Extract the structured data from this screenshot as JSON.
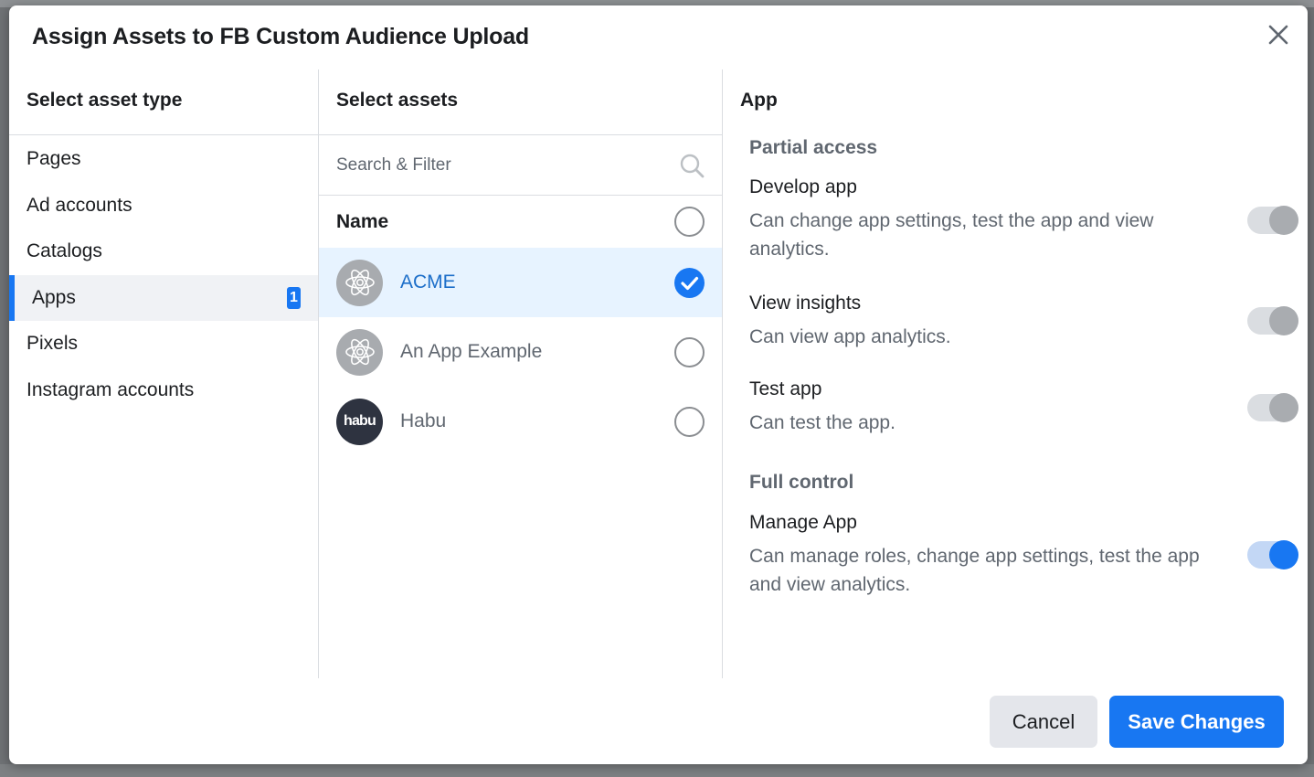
{
  "dialog": {
    "title": "Assign Assets to FB Custom Audience Upload",
    "close_icon": "close-icon"
  },
  "asset_types": {
    "header": "Select asset type",
    "items": [
      {
        "label": "Pages",
        "active": false
      },
      {
        "label": "Ad accounts",
        "active": false
      },
      {
        "label": "Catalogs",
        "active": false
      },
      {
        "label": "Apps",
        "active": true,
        "badge": "1"
      },
      {
        "label": "Pixels",
        "active": false
      },
      {
        "label": "Instagram accounts",
        "active": false
      }
    ]
  },
  "assets": {
    "header": "Select assets",
    "search_placeholder": "Search & Filter",
    "search_icon": "search-icon",
    "name_column": "Name",
    "items": [
      {
        "name": "ACME",
        "selected": true,
        "icon": "app-atom-icon"
      },
      {
        "name": "An App Example",
        "selected": false,
        "icon": "app-atom-icon"
      },
      {
        "name": "Habu",
        "selected": false,
        "icon": "habu-logo",
        "logo_text": "habu"
      }
    ]
  },
  "permissions": {
    "header": "App",
    "partial_access_title": "Partial access",
    "full_control_title": "Full control",
    "items": [
      {
        "title": "Develop app",
        "description": "Can change app settings, test the app and view analytics.",
        "enabled": false
      },
      {
        "title": "View insights",
        "description": "Can view app analytics.",
        "enabled": false
      },
      {
        "title": "Test app",
        "description": "Can test the app.",
        "enabled": false
      },
      {
        "title": "Manage App",
        "description": "Can manage roles, change app settings, test the app and view analytics.",
        "enabled": true
      }
    ]
  },
  "footer": {
    "cancel_label": "Cancel",
    "save_label": "Save Changes"
  },
  "colors": {
    "accent": "#1877f2",
    "selected_row": "#e7f3ff",
    "toggle_off_knob": "#a9acb0",
    "habu_logo_bg": "#2e3340"
  }
}
